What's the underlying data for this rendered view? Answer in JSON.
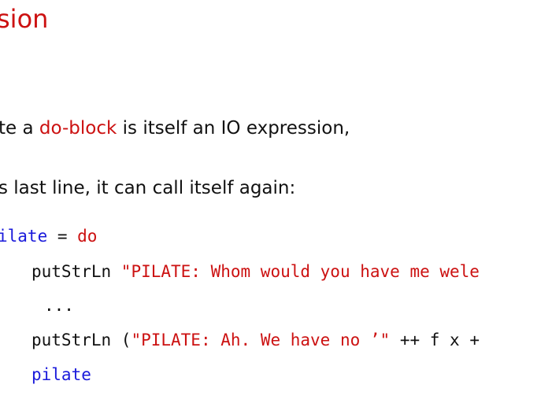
{
  "slide": {
    "title": "sion",
    "line1": {
      "before": "te a ",
      "highlight": "do-block",
      "after": " is itself an IO expression,"
    },
    "line2": "s last line, it can call itself again:",
    "code": {
      "l1_name": "ilate",
      "l1_eq": " = ",
      "l1_do": "do",
      "l2_fn": "putStrLn",
      "l2_str": " \"PILATE: Whom would you have me wele",
      "l3": "...",
      "l4_fn": "putStrLn",
      "l4_paren": " (",
      "l4_str": "\"PILATE: Ah. We have no ’\"",
      "l4_rest": " ++ f x +",
      "l5": "pilate"
    }
  }
}
